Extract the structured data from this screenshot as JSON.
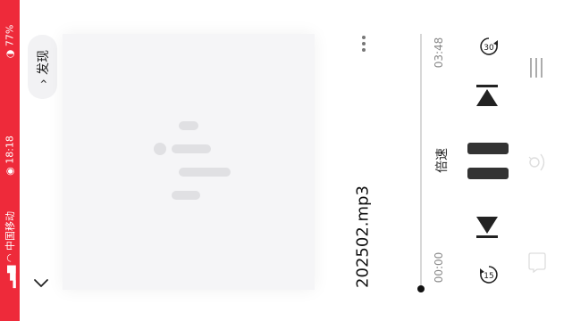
{
  "status_bar": {
    "carrier": "中国移动",
    "time": "18:18",
    "battery": "77%"
  },
  "nav": {
    "discover_label": "发现"
  },
  "player": {
    "file_name": "202502.mp3",
    "elapsed": "00:00",
    "duration": "03:48",
    "progress_fraction": 0.0,
    "speed_label": "倍速",
    "rewind_seconds": "15",
    "forward_seconds": "30"
  },
  "colors": {
    "status_bar_bg": "#ee2a3a",
    "control_dark": "#222222",
    "art_bg": "#f5f5f7"
  },
  "icons": [
    "signal-icon",
    "wifi-icon",
    "alarm-icon",
    "battery-icon",
    "chevron-down-icon",
    "more-icon",
    "rewind-15-icon",
    "previous-icon",
    "pause-icon",
    "next-icon",
    "forward-30-icon",
    "playlist-icon",
    "comment-icon",
    "share-icon"
  ]
}
